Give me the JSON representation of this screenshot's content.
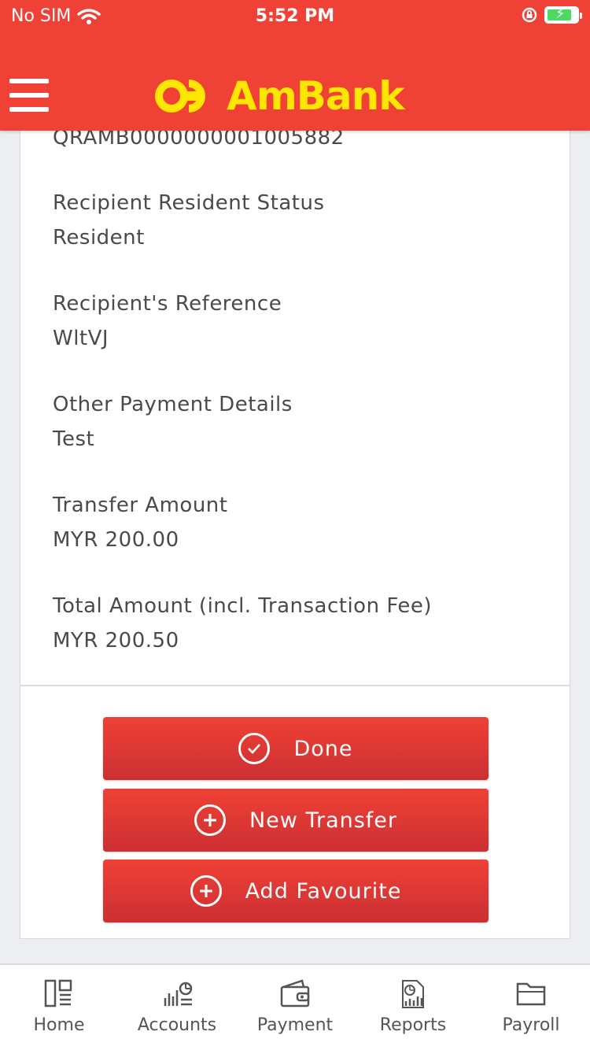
{
  "status_bar": {
    "carrier": "No SIM",
    "time": "5:52 PM"
  },
  "header": {
    "brand": "AmBank",
    "brand_color": "#ffe600",
    "bar_color": "#ef4135"
  },
  "details": {
    "partial_value": "QRAMB0000000001005882",
    "fields": [
      {
        "label": "Recipient Resident Status",
        "value": "Resident"
      },
      {
        "label": "Recipient's Reference",
        "value": "WltVJ"
      },
      {
        "label": "Other Payment Details",
        "value": "Test"
      },
      {
        "label": "Transfer Amount",
        "value": "MYR 200.00"
      },
      {
        "label": "Total Amount (incl. Transaction Fee)",
        "value": "MYR 200.50"
      }
    ]
  },
  "actions": {
    "done": "Done",
    "new_transfer": "New Transfer",
    "add_favourite": "Add Favourite"
  },
  "tabbar": {
    "items": [
      {
        "label": "Home",
        "icon": "home-icon"
      },
      {
        "label": "Accounts",
        "icon": "accounts-icon"
      },
      {
        "label": "Payment",
        "icon": "wallet-icon"
      },
      {
        "label": "Reports",
        "icon": "reports-icon"
      },
      {
        "label": "Payroll",
        "icon": "folder-icon"
      }
    ]
  }
}
